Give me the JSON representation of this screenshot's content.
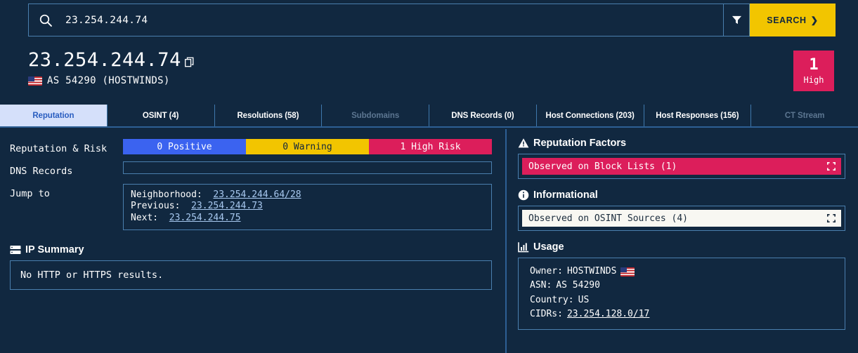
{
  "search": {
    "value": "23.254.244.74",
    "icon": "search-icon",
    "filter_icon": "filter-funnel-icon",
    "button_label": "SEARCH",
    "button_chevron": "❯"
  },
  "header": {
    "ip": "23.254.244.74",
    "copy_icon": "copy-icon",
    "flag": "us-flag-icon",
    "asn_line": "AS 54290 (HOSTWINDS)"
  },
  "risk_badge": {
    "count": "1",
    "level": "High",
    "color": "#dc1e5b"
  },
  "tabs": [
    {
      "label": "Reputation",
      "active": true,
      "disabled": false
    },
    {
      "label": "OSINT (4)",
      "active": false,
      "disabled": false
    },
    {
      "label": "Resolutions (58)",
      "active": false,
      "disabled": false
    },
    {
      "label": "Subdomains",
      "active": false,
      "disabled": true
    },
    {
      "label": "DNS Records (0)",
      "active": false,
      "disabled": false
    },
    {
      "label": "Host Connections (203)",
      "active": false,
      "disabled": false
    },
    {
      "label": "Host Responses (156)",
      "active": false,
      "disabled": false
    },
    {
      "label": "CT Stream",
      "active": false,
      "disabled": true
    }
  ],
  "left": {
    "reputation_risk": {
      "label": "Reputation & Risk",
      "segments": [
        {
          "text": "0 Positive",
          "color": "#3b63f0"
        },
        {
          "text": "0 Warning",
          "color": "#f2c500"
        },
        {
          "text": "1 High Risk",
          "color": "#dc1e5b"
        }
      ]
    },
    "dns_records": {
      "label": "DNS Records",
      "value": ""
    },
    "jump_to": {
      "label": "Jump to",
      "rows": [
        {
          "name": "Neighborhood:",
          "link": "23.254.244.64/28"
        },
        {
          "name": "Previous:",
          "link": "23.254.244.73"
        },
        {
          "name": "Next:",
          "link": "23.254.244.75"
        }
      ]
    },
    "ip_summary": {
      "icon": "server-stack-icon",
      "title": "IP Summary",
      "body": "No HTTP or HTTPS results."
    }
  },
  "right": {
    "reputation_factors": {
      "icon": "warning-triangle-icon",
      "title": "Reputation Factors",
      "items": [
        {
          "text": "Observed on Block Lists (1)",
          "style": "danger",
          "expand_icon": "expand-icon"
        }
      ]
    },
    "informational": {
      "icon": "info-circle-icon",
      "title": "Informational",
      "items": [
        {
          "text": "Observed on OSINT Sources (4)",
          "style": "info",
          "expand_icon": "expand-icon"
        }
      ]
    },
    "usage": {
      "icon": "bar-chart-icon",
      "title": "Usage",
      "owner_label": "Owner:",
      "owner_value": "HOSTWINDS",
      "owner_flag": "us-flag-icon",
      "asn_label": "ASN:",
      "asn_value": "AS 54290",
      "country_label": "Country:",
      "country_value": "US",
      "cidr_label": "CIDRs:",
      "cidr_value": "23.254.128.0/17"
    }
  },
  "colors": {
    "background": "#112840",
    "accent_blue": "#3b63f0",
    "accent_yellow": "#f2c500",
    "accent_crimson": "#dc1e5b",
    "border": "#4a7fae",
    "active_tab_bg": "#d5e0fa",
    "active_tab_fg": "#2a5ec0"
  }
}
